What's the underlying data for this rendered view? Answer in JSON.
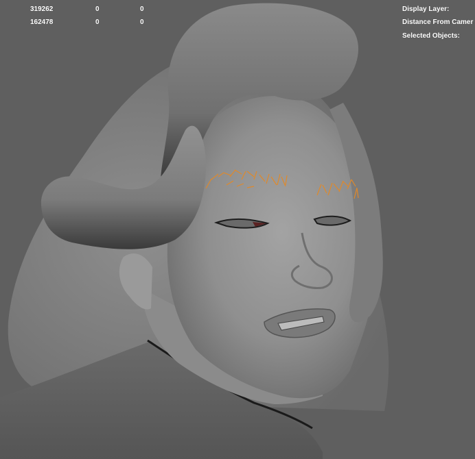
{
  "hud_left": {
    "rows": [
      {
        "col1": "319262",
        "col2": "0",
        "col3": "0"
      },
      {
        "col1": "162478",
        "col2": "0",
        "col3": "0"
      }
    ]
  },
  "hud_right": {
    "display_layer": "Display Layer:",
    "distance_from_camera": "Distance From Camer",
    "selected_objects": "Selected Objects:"
  },
  "colors": {
    "viewport_bg": "#5f5f5f",
    "mesh_shading": "#8a8a8a",
    "eyebrow_hair": "#e0892a",
    "hud_text": "#ffffff"
  }
}
